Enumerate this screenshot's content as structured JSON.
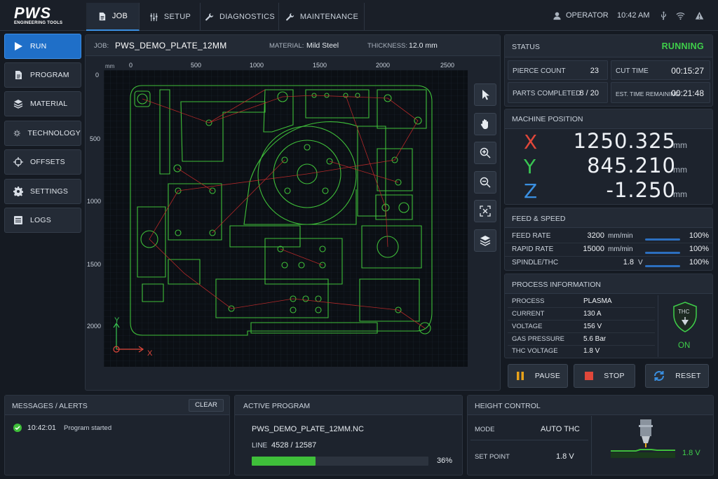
{
  "brand": {
    "name": "PWS",
    "tagline": "ENGINEERING TOOLS"
  },
  "top_tabs": [
    {
      "label": "JOB",
      "icon": "document-icon",
      "active": true
    },
    {
      "label": "SETUP",
      "icon": "sliders-icon",
      "active": false
    },
    {
      "label": "DIAGNOSTICS",
      "icon": "wrench-icon",
      "active": false
    },
    {
      "label": "MAINTENANCE",
      "icon": "wrench-icon",
      "active": false
    }
  ],
  "top_right": {
    "user": "OPERATOR",
    "time": "10:42 AM"
  },
  "sidebar": {
    "items": [
      {
        "label": "RUN",
        "icon": "play-icon",
        "active": true
      },
      {
        "label": "PROGRAM",
        "icon": "document-icon",
        "active": false
      },
      {
        "label": "MATERIAL",
        "icon": "layers-icon",
        "active": false
      },
      {
        "label": "TECHNOLOGY",
        "icon": "spark-icon",
        "active": false
      },
      {
        "label": "OFFSETS",
        "icon": "crosshair-icon",
        "active": false
      },
      {
        "label": "SETTINGS",
        "icon": "gear-icon",
        "active": false
      },
      {
        "label": "LOGS",
        "icon": "list-icon",
        "active": false
      }
    ]
  },
  "job": {
    "job_label": "JOB:",
    "job_name": "PWS_DEMO_PLATE_12MM",
    "material_label": "MATERIAL:",
    "material": "Mild Steel",
    "thickness_label": "THICKNESS:",
    "thickness": "12.0 mm"
  },
  "canvas": {
    "unit": "mm",
    "x_ticks": [
      "0",
      "500",
      "1000",
      "1500",
      "2000",
      "2500"
    ],
    "y_ticks": [
      "0",
      "500",
      "1000",
      "1500",
      "2000"
    ],
    "axis_x": "X",
    "axis_y": "Y"
  },
  "status": {
    "title": "STATUS",
    "state": "RUNNING",
    "state_color": "#3fcf4a",
    "pierce_label": "PIERCE COUNT",
    "pierce": "23",
    "cut_time_label": "CUT TIME",
    "cut_time": "00:15:27",
    "parts_label": "PARTS COMPLETED",
    "parts": "8 / 20",
    "est_label": "EST. TIME REMAINING",
    "est": "00:21:48"
  },
  "machine_position": {
    "title": "MACHINE POSITION",
    "axes": [
      {
        "axis": "X",
        "value": "1250.325",
        "unit": "mm",
        "color": "#e0473a"
      },
      {
        "axis": "Y",
        "value": "845.210",
        "unit": "mm",
        "color": "#39c452"
      },
      {
        "axis": "Z",
        "value": "-1.250",
        "unit": "mm",
        "color": "#3a8fe0"
      }
    ]
  },
  "feed_speed": {
    "title": "FEED & SPEED",
    "rows": [
      {
        "label": "FEED RATE",
        "value": "3200",
        "unit": "mm/min",
        "pct": "100%",
        "level": 1.0
      },
      {
        "label": "RAPID RATE",
        "value": "15000",
        "unit": "mm/min",
        "pct": "100%",
        "level": 1.0
      },
      {
        "label": "SPINDLE/THC",
        "value": "1.8",
        "unit": "V",
        "pct": "100%",
        "level": 1.0
      }
    ]
  },
  "process": {
    "title": "PROCESS INFORMATION",
    "rows": [
      {
        "label": "PROCESS",
        "value": "PLASMA"
      },
      {
        "label": "CURRENT",
        "value": "130 A"
      },
      {
        "label": "VOLTAGE",
        "value": "156 V"
      },
      {
        "label": "GAS PRESSURE",
        "value": "5.6 Bar"
      },
      {
        "label": "THC VOLTAGE",
        "value": "1.8 V"
      }
    ],
    "thc_badge": "THC",
    "thc_state": "ON"
  },
  "controls": {
    "pause": "PAUSE",
    "stop": "STOP",
    "reset": "RESET"
  },
  "messages": {
    "title": "MESSAGES / ALERTS",
    "clear": "CLEAR",
    "items": [
      {
        "time": "10:42:01",
        "text": "Program started"
      }
    ]
  },
  "active_program": {
    "title": "ACTIVE PROGRAM",
    "file": "PWS_DEMO_PLATE_12MM.NC",
    "line_label": "LINE",
    "line": "4528 / 12587",
    "pct": "36%",
    "progress": 0.36
  },
  "height_control": {
    "title": "HEIGHT CONTROL",
    "mode_label": "MODE",
    "mode": "AUTO THC",
    "set_label": "SET POINT",
    "set": "1.8 V",
    "reading": "1.8 V"
  }
}
